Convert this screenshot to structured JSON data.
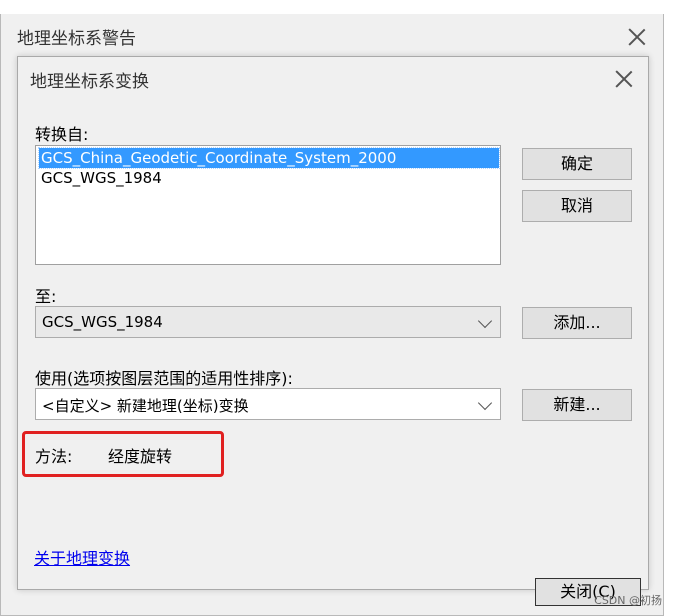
{
  "outer_dialog": {
    "title": "地理坐标系警告",
    "close_button": "close-icon",
    "close_label": "关闭(C)"
  },
  "inner_dialog": {
    "title": "地理坐标系变换",
    "from_label": "转换自:",
    "from_items": [
      {
        "label": "GCS_China_Geodetic_Coordinate_System_2000",
        "selected": true
      },
      {
        "label": "GCS_WGS_1984",
        "selected": false
      }
    ],
    "ok_label": "确定",
    "cancel_label": "取消",
    "to_label": "至:",
    "to_value": "GCS_WGS_1984",
    "add_label": "添加...",
    "use_label": "使用(选项按图层范围的适用性排序):",
    "use_value": "<自定义> 新建地理(坐标)变换",
    "new_label": "新建...",
    "method_label": "方法:",
    "method_value": "经度旋转",
    "about_link": "关于地理变换"
  },
  "watermark": "CSDN @初扬",
  "colors": {
    "selection": "#3399ff",
    "highlight": "#e02020",
    "link": "#0000ee"
  }
}
